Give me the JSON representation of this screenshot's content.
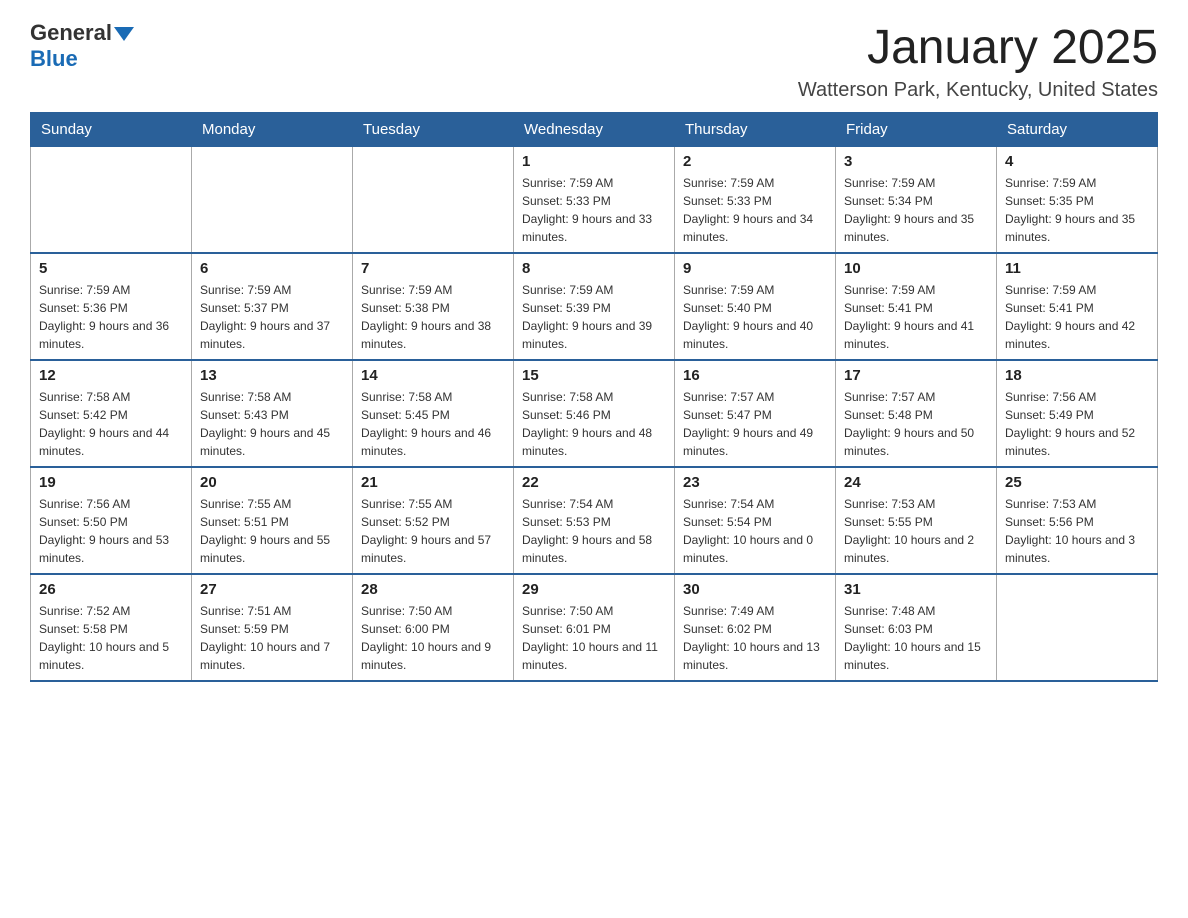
{
  "logo": {
    "general": "General",
    "blue": "Blue"
  },
  "title": "January 2025",
  "location": "Watterson Park, Kentucky, United States",
  "days_of_week": [
    "Sunday",
    "Monday",
    "Tuesday",
    "Wednesday",
    "Thursday",
    "Friday",
    "Saturday"
  ],
  "weeks": [
    [
      {
        "num": "",
        "info": ""
      },
      {
        "num": "",
        "info": ""
      },
      {
        "num": "",
        "info": ""
      },
      {
        "num": "1",
        "info": "Sunrise: 7:59 AM\nSunset: 5:33 PM\nDaylight: 9 hours and 33 minutes."
      },
      {
        "num": "2",
        "info": "Sunrise: 7:59 AM\nSunset: 5:33 PM\nDaylight: 9 hours and 34 minutes."
      },
      {
        "num": "3",
        "info": "Sunrise: 7:59 AM\nSunset: 5:34 PM\nDaylight: 9 hours and 35 minutes."
      },
      {
        "num": "4",
        "info": "Sunrise: 7:59 AM\nSunset: 5:35 PM\nDaylight: 9 hours and 35 minutes."
      }
    ],
    [
      {
        "num": "5",
        "info": "Sunrise: 7:59 AM\nSunset: 5:36 PM\nDaylight: 9 hours and 36 minutes."
      },
      {
        "num": "6",
        "info": "Sunrise: 7:59 AM\nSunset: 5:37 PM\nDaylight: 9 hours and 37 minutes."
      },
      {
        "num": "7",
        "info": "Sunrise: 7:59 AM\nSunset: 5:38 PM\nDaylight: 9 hours and 38 minutes."
      },
      {
        "num": "8",
        "info": "Sunrise: 7:59 AM\nSunset: 5:39 PM\nDaylight: 9 hours and 39 minutes."
      },
      {
        "num": "9",
        "info": "Sunrise: 7:59 AM\nSunset: 5:40 PM\nDaylight: 9 hours and 40 minutes."
      },
      {
        "num": "10",
        "info": "Sunrise: 7:59 AM\nSunset: 5:41 PM\nDaylight: 9 hours and 41 minutes."
      },
      {
        "num": "11",
        "info": "Sunrise: 7:59 AM\nSunset: 5:41 PM\nDaylight: 9 hours and 42 minutes."
      }
    ],
    [
      {
        "num": "12",
        "info": "Sunrise: 7:58 AM\nSunset: 5:42 PM\nDaylight: 9 hours and 44 minutes."
      },
      {
        "num": "13",
        "info": "Sunrise: 7:58 AM\nSunset: 5:43 PM\nDaylight: 9 hours and 45 minutes."
      },
      {
        "num": "14",
        "info": "Sunrise: 7:58 AM\nSunset: 5:45 PM\nDaylight: 9 hours and 46 minutes."
      },
      {
        "num": "15",
        "info": "Sunrise: 7:58 AM\nSunset: 5:46 PM\nDaylight: 9 hours and 48 minutes."
      },
      {
        "num": "16",
        "info": "Sunrise: 7:57 AM\nSunset: 5:47 PM\nDaylight: 9 hours and 49 minutes."
      },
      {
        "num": "17",
        "info": "Sunrise: 7:57 AM\nSunset: 5:48 PM\nDaylight: 9 hours and 50 minutes."
      },
      {
        "num": "18",
        "info": "Sunrise: 7:56 AM\nSunset: 5:49 PM\nDaylight: 9 hours and 52 minutes."
      }
    ],
    [
      {
        "num": "19",
        "info": "Sunrise: 7:56 AM\nSunset: 5:50 PM\nDaylight: 9 hours and 53 minutes."
      },
      {
        "num": "20",
        "info": "Sunrise: 7:55 AM\nSunset: 5:51 PM\nDaylight: 9 hours and 55 minutes."
      },
      {
        "num": "21",
        "info": "Sunrise: 7:55 AM\nSunset: 5:52 PM\nDaylight: 9 hours and 57 minutes."
      },
      {
        "num": "22",
        "info": "Sunrise: 7:54 AM\nSunset: 5:53 PM\nDaylight: 9 hours and 58 minutes."
      },
      {
        "num": "23",
        "info": "Sunrise: 7:54 AM\nSunset: 5:54 PM\nDaylight: 10 hours and 0 minutes."
      },
      {
        "num": "24",
        "info": "Sunrise: 7:53 AM\nSunset: 5:55 PM\nDaylight: 10 hours and 2 minutes."
      },
      {
        "num": "25",
        "info": "Sunrise: 7:53 AM\nSunset: 5:56 PM\nDaylight: 10 hours and 3 minutes."
      }
    ],
    [
      {
        "num": "26",
        "info": "Sunrise: 7:52 AM\nSunset: 5:58 PM\nDaylight: 10 hours and 5 minutes."
      },
      {
        "num": "27",
        "info": "Sunrise: 7:51 AM\nSunset: 5:59 PM\nDaylight: 10 hours and 7 minutes."
      },
      {
        "num": "28",
        "info": "Sunrise: 7:50 AM\nSunset: 6:00 PM\nDaylight: 10 hours and 9 minutes."
      },
      {
        "num": "29",
        "info": "Sunrise: 7:50 AM\nSunset: 6:01 PM\nDaylight: 10 hours and 11 minutes."
      },
      {
        "num": "30",
        "info": "Sunrise: 7:49 AM\nSunset: 6:02 PM\nDaylight: 10 hours and 13 minutes."
      },
      {
        "num": "31",
        "info": "Sunrise: 7:48 AM\nSunset: 6:03 PM\nDaylight: 10 hours and 15 minutes."
      },
      {
        "num": "",
        "info": ""
      }
    ]
  ]
}
